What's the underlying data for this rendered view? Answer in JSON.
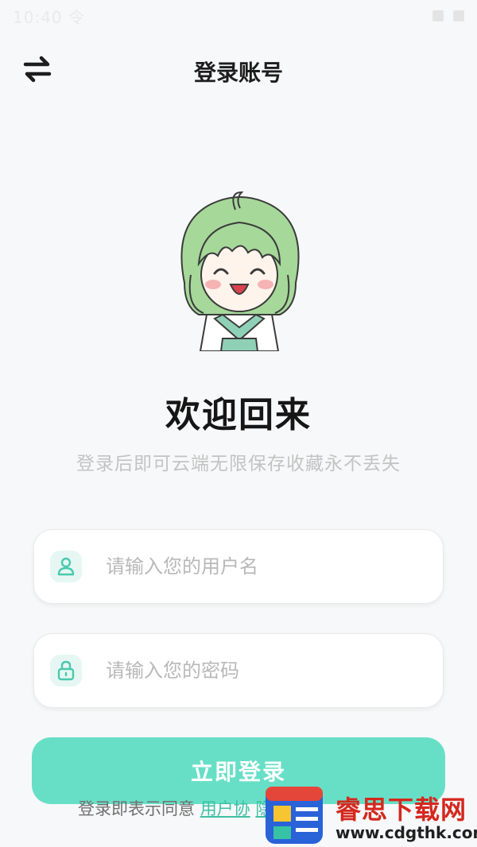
{
  "status_bar": {
    "time": "10:40 令"
  },
  "header": {
    "title": "登录账号",
    "switch_icon": "swap-arrows-icon"
  },
  "welcome": {
    "title": "欢迎回来",
    "subtitle": "登录后即可云端无限保存收藏永不丢失"
  },
  "form": {
    "username_placeholder": "请输入您的用户名",
    "password_placeholder": "请输入您的密码",
    "login_button": "立即登录"
  },
  "agreement": {
    "prefix": "登录即表示同意 ",
    "user_agreement": "用户协",
    "privacy_policy": "隐私协议"
  },
  "watermark": {
    "text": "睿思下载网",
    "url": "www.cdgthk.com"
  },
  "colors": {
    "accent": "#67dfc7",
    "link": "#3dbfa4",
    "background": "#f7f8f9"
  }
}
